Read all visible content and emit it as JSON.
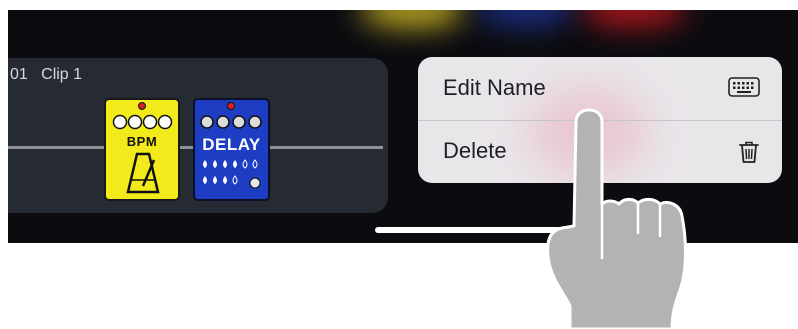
{
  "clip": {
    "title": "01   Clip 1"
  },
  "pedals": [
    {
      "name": "BPM",
      "color": "#f2ea1a"
    },
    {
      "name": "DELAY",
      "color": "#1d3ec2"
    }
  ],
  "context_menu": {
    "items": [
      {
        "label": "Edit Name",
        "icon": "keyboard-icon"
      },
      {
        "label": "Delete",
        "icon": "trash-icon"
      }
    ]
  },
  "colors": {
    "screen_bg": "#0c0c10",
    "panel_bg": "#262a33",
    "menu_bg": "#e9e6ea"
  }
}
